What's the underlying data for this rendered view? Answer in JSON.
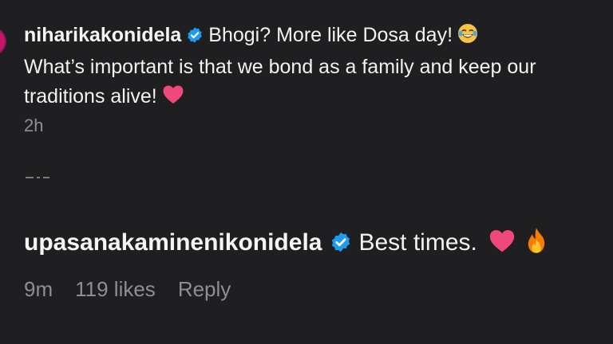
{
  "top_comment": {
    "username": "niharikakonidela",
    "verified_icon": "verified-badge-icon",
    "line1": "Bhogi? More like Dosa day!",
    "line1_emoji": "laughing-crying-emoji-icon",
    "line2": "What’s important is that we bond as a family and keep our",
    "line3": "traditions alive!",
    "line3_emoji": "pink-heart-emoji-icon",
    "time": "2h"
  },
  "reply_comment": {
    "username": "upasanakaminenikonidela",
    "verified_icon": "verified-badge-icon",
    "text": "Best times.",
    "emojis": [
      "pink-heart-emoji-icon",
      "fire-emoji-icon"
    ],
    "time": "9m",
    "likes": "119 likes",
    "reply_label": "Reply"
  },
  "colors": {
    "background": "#1f1f21",
    "verified_blue": "#1d9bf0",
    "heart_pink": "#f0487a",
    "muted_text": "#8e8e93"
  }
}
